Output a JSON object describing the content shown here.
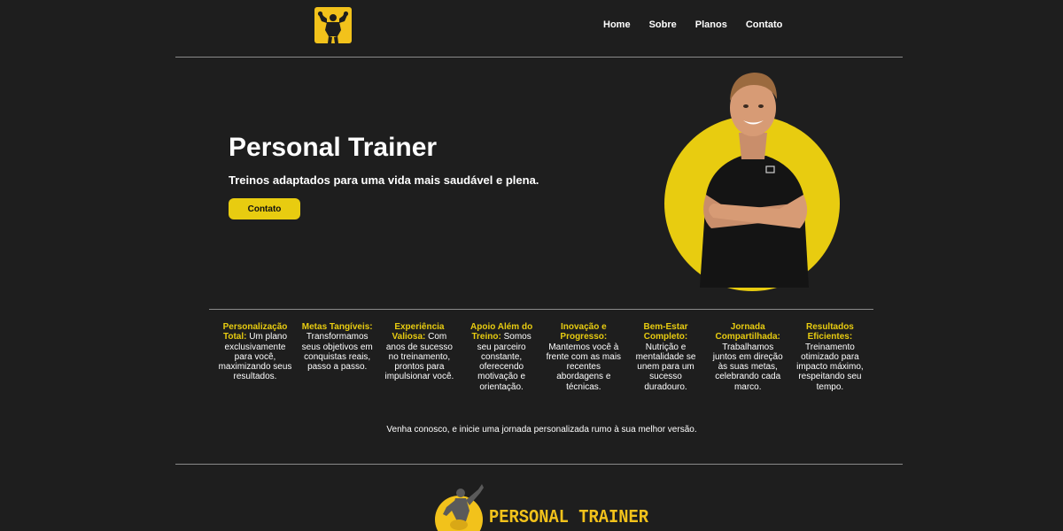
{
  "header": {
    "logo_icon": "bodybuilder-flex-icon",
    "nav": [
      {
        "label": "Home"
      },
      {
        "label": "Sobre"
      },
      {
        "label": "Planos"
      },
      {
        "label": "Contato"
      }
    ]
  },
  "hero": {
    "title": "Personal Trainer",
    "subtitle": "Treinos adaptados para uma vida mais saudável e plena.",
    "cta_label": "Contato",
    "photo": "trainer-portrait-image"
  },
  "features": [
    {
      "title": "Personalização Total:",
      "text": " Um plano exclusivamente para você, maximizando seus resultados."
    },
    {
      "title": "Metas Tangíveis:",
      "text": " Transformamos seus objetivos em conquistas reais, passo a passo."
    },
    {
      "title": "Experiência Valiosa:",
      "text": " Com anos de sucesso no treinamento, prontos para impulsionar você."
    },
    {
      "title": "Apoio Além do Treino:",
      "text": " Somos seu parceiro constante, oferecendo motivação e orientação."
    },
    {
      "title": "Inovação e Progresso:",
      "text": " Mantemos você à frente com as mais recentes abordagens e técnicas."
    },
    {
      "title": "Bem-Estar Completo:",
      "text": " Nutrição e mentalidade se unem para um sucesso duradouro."
    },
    {
      "title": "Jornada Compartilhada:",
      "text": " Trabalhamos juntos em direção às suas metas, celebrando cada marco."
    },
    {
      "title": "Resultados Eficientes:",
      "text": " Treinamento otimizado para impacto máximo, respeitando seu tempo."
    }
  ],
  "tagline": "Venha conosco, e inicie uma jornada personalizada rumo à sua melhor versão.",
  "footer": {
    "logo_text": "PERSONAL TRAINER",
    "logo_icon": "athlete-emblem-icon"
  },
  "colors": {
    "background": "#1e1e1e",
    "accent": "#e8cc10",
    "logo_yellow": "#f2c21b",
    "divider": "#8a8a8a"
  }
}
